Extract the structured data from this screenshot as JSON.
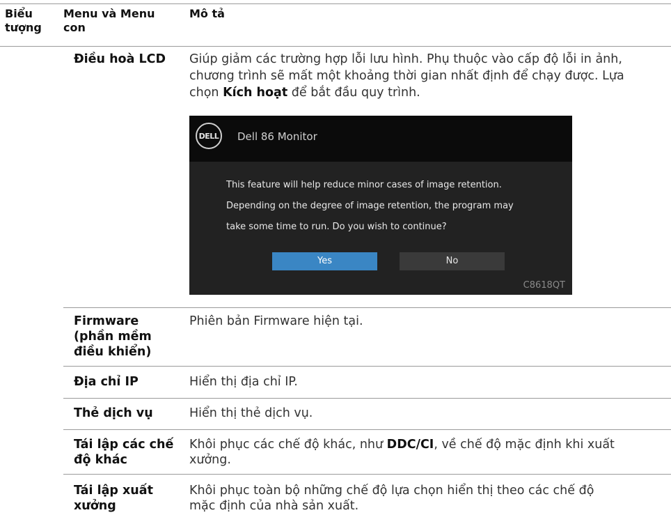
{
  "header": {
    "col1": [
      "Biểu",
      "tượng"
    ],
    "col2": [
      "Menu và Menu",
      "con"
    ],
    "col3": "Mô tả"
  },
  "rows": [
    {
      "menu": [
        "Điều hoà LCD"
      ],
      "desc_lines": [
        "Giúp giảm các trường hợp lỗi lưu hình. Phụ thuộc vào cấp độ lỗi in ảnh,",
        "chương trình sẽ mất một khoảng thời gian nhất định để chạy được. Lựa"
      ],
      "desc_last": {
        "pre": "chọn ",
        "bold": "Kích hoạt",
        "post": " để bắt đầu quy trình."
      }
    },
    {
      "menu": [
        "Firmware",
        "(phần mềm",
        "điều khiển)"
      ],
      "desc_lines": [
        "Phiên bản Firmware hiện tại."
      ]
    },
    {
      "menu": [
        "Địa chỉ IP"
      ],
      "desc_lines": [
        "Hiển thị địa chỉ IP."
      ]
    },
    {
      "menu": [
        "Thẻ dịch vụ"
      ],
      "desc_lines": [
        "Hiển thị thẻ dịch vụ."
      ]
    },
    {
      "menu": [
        "Tái lập các chế",
        "độ khác"
      ],
      "desc_first": {
        "pre": " Khôi phục các chế độ khác, như ",
        "bold": "DDC/CI",
        "post": ", về chế độ mặc định khi xuất"
      },
      "desc_lines": [
        "xưởng."
      ]
    },
    {
      "menu": [
        "Tái lập xuất",
        "xưởng"
      ],
      "desc_lines": [
        "Khôi phục toàn bộ những chế độ lựa chọn hiển thị theo các chế độ",
        "mặc định của nhà sản xuất."
      ]
    }
  ],
  "dialog": {
    "logo": "DELL",
    "title": "Dell 86 Monitor",
    "messages": [
      "This feature will help reduce minor cases of image retention.",
      "Depending on the degree of image retention, the program may",
      "take some time to run. Do you wish to continue?"
    ],
    "yes_label": "Yes",
    "no_label": "No",
    "model": "C8618QT",
    "colors": {
      "background": "#222222",
      "header": "#0b0b0b",
      "yes": "#3a86c4",
      "no": "#3a3a3a"
    }
  }
}
